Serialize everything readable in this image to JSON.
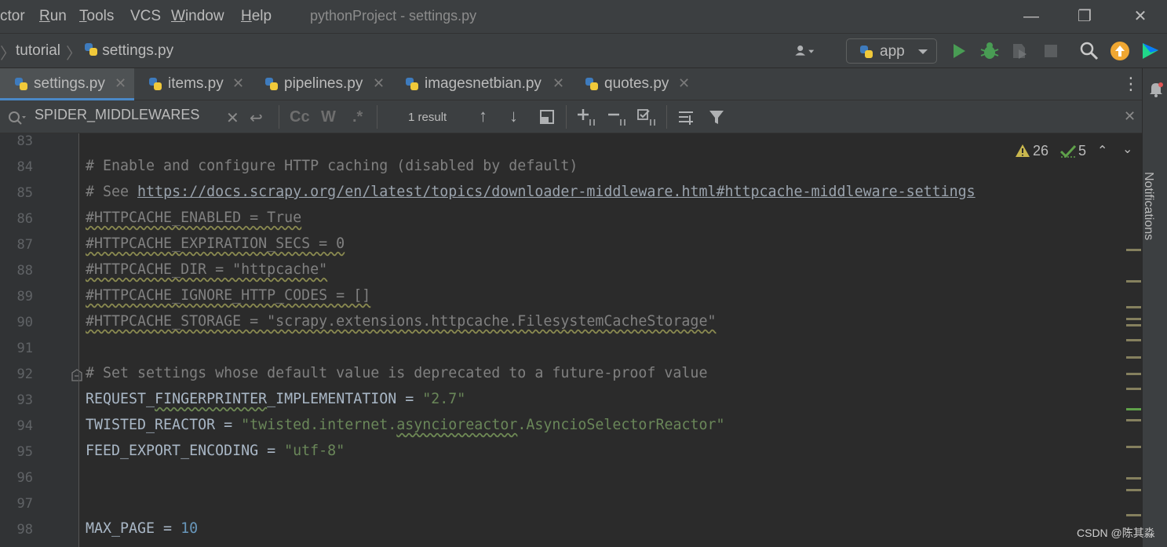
{
  "menu": {
    "items": [
      "ctor",
      "Run",
      "Tools",
      "VCS",
      "Window",
      "Help"
    ],
    "window_title": "pythonProject - settings.py"
  },
  "window_controls": {
    "minimize": "—",
    "restore": "❐",
    "close": "✕"
  },
  "breadcrumb": {
    "items": [
      "tutorial",
      "settings.py"
    ]
  },
  "toolbar": {
    "run_config": "app"
  },
  "tabs": [
    {
      "label": "settings.py",
      "active": true
    },
    {
      "label": "items.py",
      "active": false
    },
    {
      "label": "pipelines.py",
      "active": false
    },
    {
      "label": "imagesnetbian.py",
      "active": false
    },
    {
      "label": "quotes.py",
      "active": false
    }
  ],
  "find": {
    "query": "SPIDER_MIDDLEWARES",
    "result_count": "1 result",
    "match_case": "Cc",
    "words": "W",
    "regex": ".*"
  },
  "inspections": {
    "warnings": "26",
    "weak_warnings": "5"
  },
  "editor": {
    "lines": [
      {
        "n": "83"
      },
      {
        "n": "84",
        "c1": "# Enable and configure HTTP caching (disabled by default)"
      },
      {
        "n": "85",
        "c1": "# See ",
        "link": "https://docs.scrapy.org/en/latest/topics/downloader-middleware.html#httpcache-middleware-settings"
      },
      {
        "n": "86",
        "c1": "#HTTPCACHE_ENABLED = True"
      },
      {
        "n": "87",
        "c1": "#HTTPCACHE_EXPIRATION_SECS = 0"
      },
      {
        "n": "88",
        "c1": "#HTTPCACHE_DIR = \"httpcache\""
      },
      {
        "n": "89",
        "c1": "#HTTPCACHE_IGNORE_HTTP_CODES = []"
      },
      {
        "n": "90",
        "c1": "#HTTPCACHE_STORAGE = \"scrapy.extensions.httpcache.FilesystemCacheStorage\""
      },
      {
        "n": "91"
      },
      {
        "n": "92",
        "c1": "# Set settings whose default value is deprecated to a future-proof value"
      },
      {
        "n": "93",
        "id1": "REQUEST_",
        "id2": "FINGERPRINTER",
        "id3": "_IMPLEMENTATION = ",
        "s": "\"2.7\""
      },
      {
        "n": "94",
        "id1": "TWISTED_REACTOR = ",
        "s1": "\"twisted.internet.",
        "s2": "asyncioreactor",
        "s3": ".AsyncioSelectorReactor\""
      },
      {
        "n": "95",
        "id1": "FEED_EXPORT_ENCODING = ",
        "s": "\"utf-8\""
      },
      {
        "n": "96"
      },
      {
        "n": "97"
      },
      {
        "n": "98",
        "id1": "MAX_PAGE = ",
        "num": "10"
      }
    ]
  },
  "notifications_label": "Notifications",
  "watermark": "CSDN @陈其淼",
  "colors": {
    "accent": "#4a88c7",
    "run_green": "#499c54",
    "update_orange": "#f0a732"
  }
}
